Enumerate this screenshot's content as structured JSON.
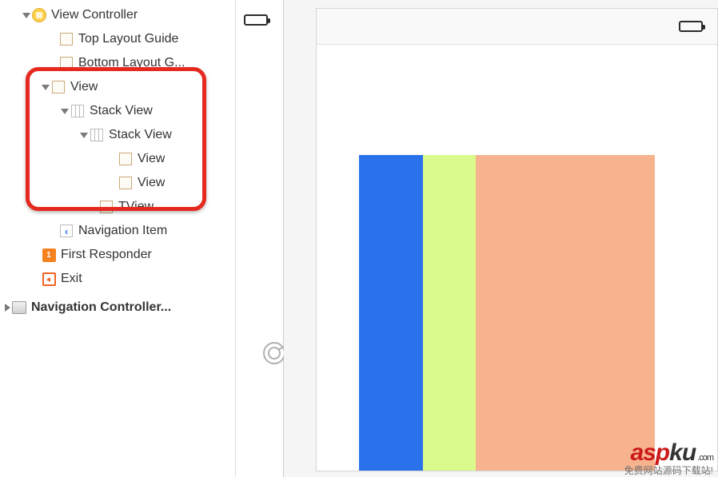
{
  "outline": {
    "view_controller": "View Controller",
    "top_layout_guide": "Top Layout Guide",
    "bottom_layout_guide": "Bottom Layout G...",
    "view": "View",
    "stack_view_outer": "Stack View",
    "stack_view_inner": "Stack View",
    "view_child_1": "View",
    "view_child_2": "View",
    "tview": "TView",
    "navigation_item": "Navigation Item",
    "first_responder": "First Responder",
    "exit": "Exit",
    "navigation_controller": "Navigation Controller..."
  },
  "canvas": {
    "columns": [
      "blue",
      "green",
      "salmon"
    ]
  },
  "watermark": {
    "brand_asp": "asp",
    "brand_ku": "ku",
    "dotcom": ".com",
    "subtitle": "免费网站源码下载站!"
  }
}
